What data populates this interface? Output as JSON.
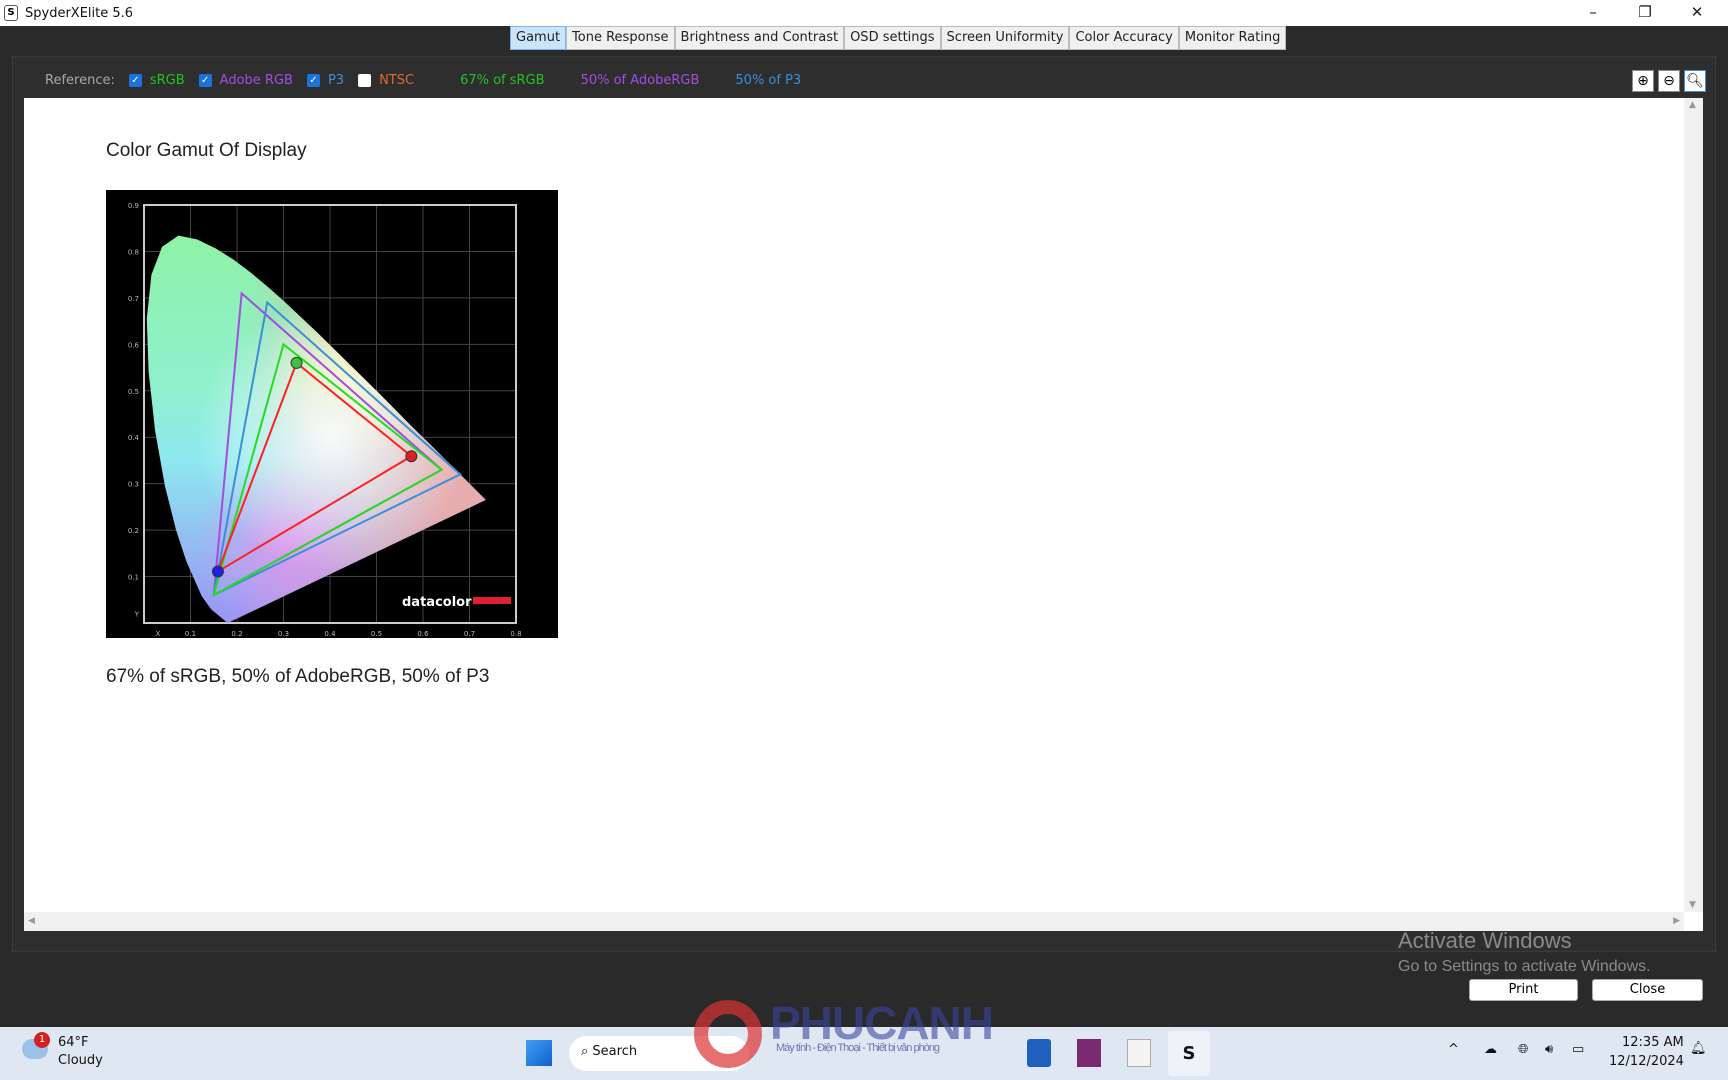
{
  "window": {
    "title": "SpyderXElite 5.6",
    "app_icon": "S",
    "minimize": "–",
    "restore": "❐",
    "close": "✕"
  },
  "tabs": [
    {
      "label": "Gamut",
      "active": true
    },
    {
      "label": "Tone Response"
    },
    {
      "label": "Brightness and Contrast"
    },
    {
      "label": "OSD settings"
    },
    {
      "label": "Screen Uniformity"
    },
    {
      "label": "Color Accuracy"
    },
    {
      "label": "Monitor Rating"
    }
  ],
  "reference": {
    "label": "Reference:",
    "items": [
      {
        "label": "sRGB",
        "checked": true,
        "color": "#22c322"
      },
      {
        "label": "Adobe RGB",
        "checked": true,
        "color": "#a04fe0"
      },
      {
        "label": "P3",
        "checked": true,
        "color": "#3a8fd8"
      },
      {
        "label": "NTSC",
        "checked": false,
        "color": "#e0692f"
      }
    ],
    "results": [
      {
        "text": "67% of sRGB",
        "color": "#22c322"
      },
      {
        "text": "50% of AdobeRGB",
        "color": "#a04fe0"
      },
      {
        "text": "50% of P3",
        "color": "#3a8fd8"
      }
    ]
  },
  "zoom_buttons": [
    "zoom-in-icon",
    "zoom-out-icon",
    "zoom-fit-icon"
  ],
  "content": {
    "title": "Color Gamut Of Display",
    "caption": "67% of sRGB, 50% of AdobeRGB, 50% of P3"
  },
  "chart_data": {
    "type": "scatter",
    "xlabel": "X",
    "ylabel": "Y",
    "xlim": [
      0,
      0.8
    ],
    "ylim": [
      0,
      0.9
    ],
    "xticks": [
      "0.1",
      "0.2",
      "0.3",
      "0.4",
      "0.5",
      "0.6",
      "0.7",
      "0.8"
    ],
    "yticks": [
      "0.1",
      "0.2",
      "0.3",
      "0.4",
      "0.5",
      "0.6",
      "0.7",
      "0.8",
      "0.9"
    ],
    "grid": true,
    "series": [
      {
        "color": "#a04fe0",
        "points": [
          [
            0.64,
            0.33
          ],
          [
            0.21,
            0.71
          ],
          [
            0.15,
            0.06
          ]
        ]
      },
      {
        "color": "#3a8fd8",
        "points": [
          [
            0.68,
            0.32
          ],
          [
            0.265,
            0.69
          ],
          [
            0.15,
            0.06
          ]
        ]
      },
      {
        "color": "#22dd22",
        "points": [
          [
            0.64,
            0.33
          ],
          [
            0.3,
            0.6
          ],
          [
            0.15,
            0.06
          ]
        ]
      },
      {
        "color": "#ff2020",
        "points": [
          [
            0.575,
            0.359
          ],
          [
            0.328,
            0.56
          ],
          [
            0.159,
            0.111
          ]
        ]
      }
    ],
    "logo": "datacolor"
  },
  "watermark": {
    "line1": "Activate Windows",
    "line2": "Go to Settings to activate Windows."
  },
  "buttons": {
    "print": "Print",
    "close": "Close"
  },
  "overlay_logo": {
    "text": "PHUCANH",
    "tagline": "Máy tính - Điện Thoại - Thiết bị văn phòng"
  },
  "taskbar": {
    "weather_badge": "1",
    "temp": "64°F",
    "condition": "Cloudy",
    "search": "Search",
    "time": "12:35 AM",
    "date": "12/12/2024"
  }
}
